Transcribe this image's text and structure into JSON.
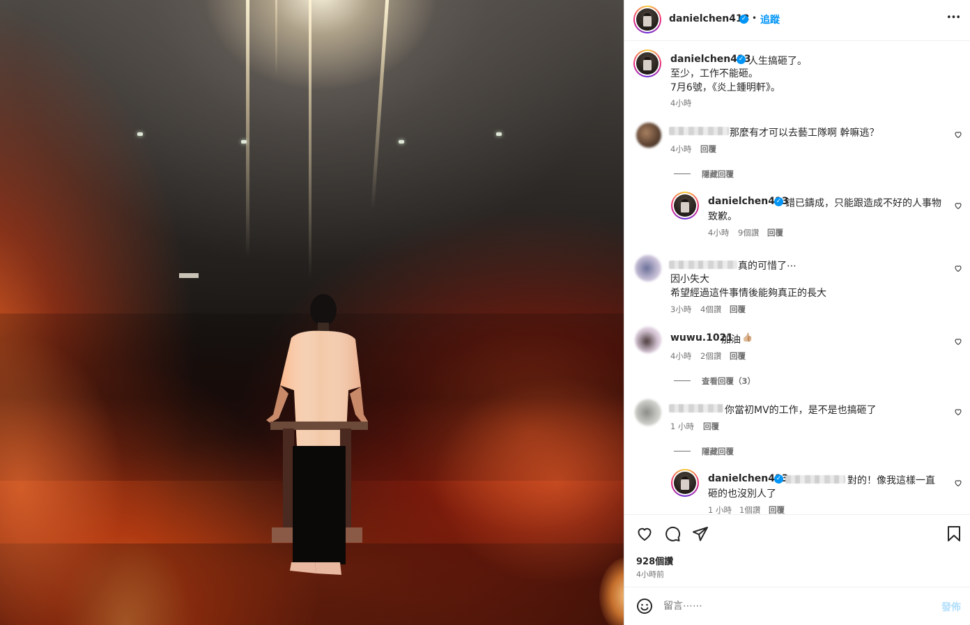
{
  "post": {
    "author": "danielchen413",
    "follow_label": "追蹤",
    "dot": "•",
    "more_label": "•••",
    "caption": {
      "line1": "人生搞砸了。",
      "line2": "至少，工作不能砸。",
      "line3": "7月6號，《炎上鍾明軒》。",
      "time": "4小時"
    }
  },
  "comments": [
    {
      "text": "那麼有才可以去藝工隊啊 幹嘛逃？",
      "time": "4小時",
      "reply_label": "回覆"
    },
    {
      "toggle": "隱藏回覆"
    },
    {
      "author": "danielchen413",
      "text_line1": "錯已鑄成，只能跟造成不好的人事物",
      "text_line2": "致歉。",
      "time": "4小時",
      "likes": "9個讚",
      "reply_label": "回覆"
    },
    {
      "text_line1": "真的可惜了⋯",
      "text_line2": "因小失大",
      "text_line3": "希望經過這件事情後能夠真正的長大",
      "time": "3小時",
      "likes": "4個讚",
      "reply_label": "回覆"
    },
    {
      "author": "wuwu.1021",
      "text": "加油",
      "emoji": "👍🏼",
      "time": "4小時",
      "likes": "2個讚",
      "reply_label": "回覆"
    },
    {
      "toggle": "查看回覆（3）"
    },
    {
      "text": "你當初MV的工作，是不是也搞砸了",
      "time": "1 小時",
      "reply_label": "回覆"
    },
    {
      "toggle": "隱藏回覆"
    },
    {
      "author": "danielchen413",
      "text_line1": "對的！像我這樣一直",
      "text_line2": "砸的也沒別人了",
      "time": "1 小時",
      "likes": "1個讚",
      "reply_label": "回覆"
    }
  ],
  "actions": {
    "likes": "928個讚",
    "time": "4小時前"
  },
  "comment_input": {
    "placeholder": "留言⋯⋯",
    "post_label": "發佈"
  },
  "icons": {
    "verified": "verified-badge",
    "like": "heart-icon",
    "comment": "comment-icon",
    "share": "share-icon",
    "save": "bookmark-icon",
    "emoji": "emoji-icon"
  },
  "colors": {
    "verified": "#0095f6",
    "post_button": "#b2dffc",
    "secondary_text": "#737373"
  }
}
